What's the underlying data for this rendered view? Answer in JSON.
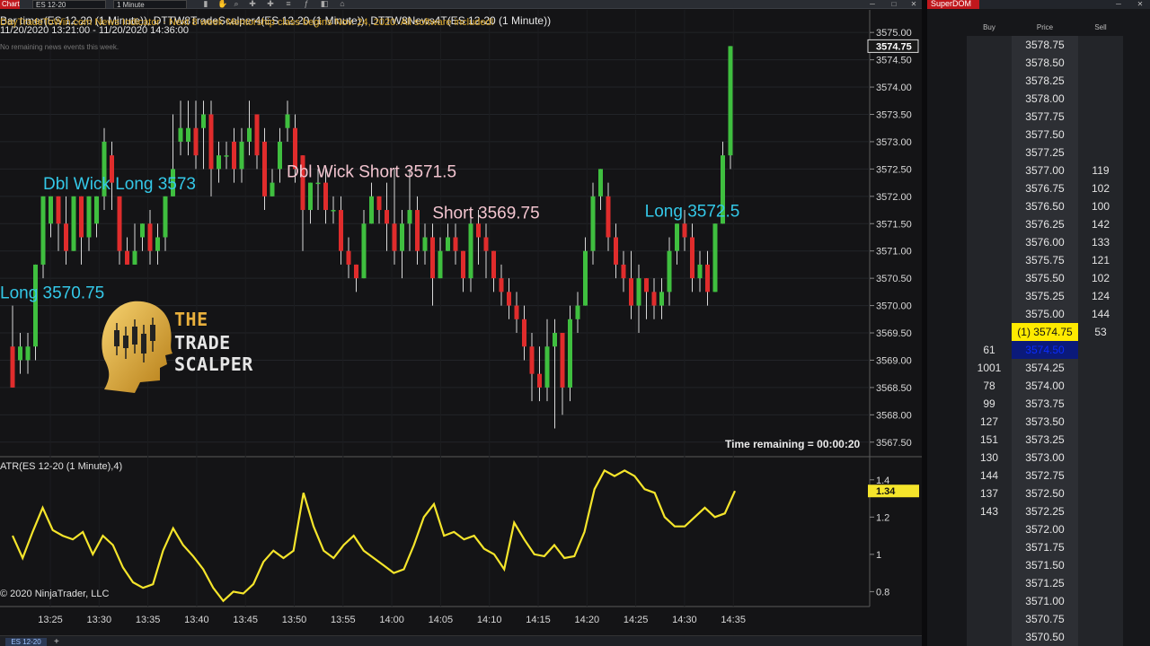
{
  "toolbar": {
    "tab_label": "Chart",
    "instrument": "ES 12-20",
    "interval": "1 Minute"
  },
  "header": {
    "title": "Bar timer(ES 12-20 (1 Minute)), DTTW8TradeScalper4(ES 12-20 (1 Minute)), DTTW8News4T(ES 12-20 (1 Minute))",
    "range": "11/20/2020 13:21:00 - 11/20/2020 14:36:00",
    "news": "DayTradeToWin.com News Indicator · Next 8 week Mentorship class begins Nov. 24, 2020. All software included!",
    "news2": "No remaining news events this week."
  },
  "logo": {
    "line1": "THE",
    "line2": "TRADE SCALPER"
  },
  "status": {
    "time_remaining": "Time remaining = 00:00:20",
    "copyright": "© 2020 NinjaTrader, LLC",
    "atr_label": "ATR(ES 12-20 (1 Minute),4)",
    "bottom_tab": "ES 12-20",
    "plus": "+"
  },
  "colors": {
    "up": "#3fbf3f",
    "down": "#e02c2c",
    "wick": "#d8d8d8",
    "atr_line": "#f5e52b",
    "signal_long": "#34c8e8",
    "signal_short": "#f2c4cf",
    "last_price_bg": "#ffea00"
  },
  "chart_data": [
    {
      "type": "candlestick",
      "title": "",
      "y_ticks": [
        3567.5,
        3568.0,
        3568.5,
        3569.0,
        3569.5,
        3570.0,
        3570.5,
        3571.0,
        3571.5,
        3572.0,
        3572.5,
        3573.0,
        3573.5,
        3574.0,
        3574.5,
        3575.0
      ],
      "y_tick_labels": [
        "3567.50",
        "3568.00",
        "3568.50",
        "3569.00",
        "3569.50",
        "3570.00",
        "3570.50",
        "3571.00",
        "3571.50",
        "3572.00",
        "3572.50",
        "3573.00",
        "3573.50",
        "3574.00",
        "3574.50",
        "3575.00"
      ],
      "ylim": [
        3567.25,
        3575.2
      ],
      "x_tick_labels": [
        "13:25",
        "13:30",
        "13:35",
        "13:40",
        "13:45",
        "13:50",
        "13:55",
        "14:00",
        "14:05",
        "14:10",
        "14:15",
        "14:20",
        "14:25",
        "14:30",
        "14:35"
      ],
      "last_price_label": "3574.75",
      "candles": [
        [
          3569.25,
          3568.5,
          3570.0,
          3568.5
        ],
        [
          3569.0,
          3569.25,
          3569.5,
          3568.75
        ],
        [
          3569.0,
          3569.25,
          3569.5,
          3568.75
        ],
        [
          3569.25,
          3570.75,
          3570.75,
          3569.0
        ],
        [
          3570.75,
          3572.0,
          3572.0,
          3570.5
        ],
        [
          3571.5,
          3572.0,
          3572.0,
          3571.25
        ],
        [
          3572.0,
          3571.5,
          3572.0,
          3571.0
        ],
        [
          3571.5,
          3571.0,
          3572.0,
          3570.75
        ],
        [
          3571.0,
          3572.0,
          3572.0,
          3571.0
        ],
        [
          3572.0,
          3571.25,
          3572.0,
          3570.75
        ],
        [
          3571.25,
          3572.0,
          3572.0,
          3571.0
        ],
        [
          3571.5,
          3572.0,
          3572.0,
          3571.25
        ],
        [
          3572.0,
          3573.0,
          3573.25,
          3571.75
        ],
        [
          3572.75,
          3572.25,
          3573.0,
          3571.75
        ],
        [
          3572.0,
          3571.0,
          3572.0,
          3570.75
        ],
        [
          3571.0,
          3570.75,
          3571.25,
          3570.75
        ],
        [
          3570.75,
          3571.0,
          3571.5,
          3570.75
        ],
        [
          3571.25,
          3571.5,
          3571.5,
          3571.0
        ],
        [
          3571.5,
          3571.0,
          3571.75,
          3570.75
        ],
        [
          3571.0,
          3571.25,
          3571.5,
          3570.75
        ],
        [
          3571.25,
          3572.0,
          3572.0,
          3571.0
        ],
        [
          3572.0,
          3572.5,
          3573.5,
          3572.0
        ],
        [
          3573.0,
          3573.25,
          3573.75,
          3572.75
        ],
        [
          3573.0,
          3573.25,
          3573.75,
          3572.75
        ],
        [
          3573.25,
          3572.75,
          3573.75,
          3572.5
        ],
        [
          3573.25,
          3573.5,
          3573.75,
          3572.5
        ],
        [
          3573.5,
          3572.5,
          3573.75,
          3572.0
        ],
        [
          3572.5,
          3572.75,
          3573.0,
          3572.25
        ],
        [
          3572.75,
          3572.75,
          3573.0,
          3572.5
        ],
        [
          3573.0,
          3572.5,
          3573.25,
          3572.25
        ],
        [
          3572.5,
          3573.0,
          3573.25,
          3572.25
        ],
        [
          3573.0,
          3573.25,
          3573.75,
          3572.75
        ],
        [
          3573.5,
          3572.75,
          3573.5,
          3572.5
        ],
        [
          3573.0,
          3572.0,
          3573.25,
          3571.75
        ],
        [
          3572.0,
          3572.25,
          3572.5,
          3572.0
        ],
        [
          3572.5,
          3573.0,
          3573.25,
          3572.25
        ],
        [
          3573.25,
          3573.5,
          3573.75,
          3573.0
        ],
        [
          3573.25,
          3572.5,
          3573.5,
          3572.25
        ],
        [
          3572.75,
          3571.75,
          3572.75,
          3571.0
        ],
        [
          3571.75,
          3572.25,
          3572.25,
          3571.5
        ],
        [
          3572.25,
          3572.25,
          3572.5,
          3571.75
        ],
        [
          3572.25,
          3571.75,
          3572.5,
          3571.5
        ],
        [
          3571.75,
          3571.75,
          3572.0,
          3571.5
        ],
        [
          3571.75,
          3571.0,
          3572.0,
          3570.75
        ],
        [
          3571.0,
          3570.75,
          3571.25,
          3570.5
        ],
        [
          3570.75,
          3570.5,
          3570.75,
          3570.25
        ],
        [
          3570.5,
          3571.5,
          3571.75,
          3570.5
        ],
        [
          3571.5,
          3572.0,
          3572.25,
          3571.5
        ],
        [
          3572.0,
          3571.75,
          3572.0,
          3571.5
        ],
        [
          3571.75,
          3571.5,
          3572.25,
          3571.0
        ],
        [
          3571.5,
          3571.0,
          3572.5,
          3570.75
        ],
        [
          3571.0,
          3571.5,
          3571.75,
          3570.5
        ],
        [
          3571.5,
          3571.75,
          3572.5,
          3571.0
        ],
        [
          3571.75,
          3571.0,
          3572.0,
          3570.75
        ],
        [
          3571.0,
          3571.25,
          3571.5,
          3570.75
        ],
        [
          3571.25,
          3570.5,
          3571.5,
          3570.0
        ],
        [
          3570.5,
          3571.0,
          3571.25,
          3570.5
        ],
        [
          3571.0,
          3571.25,
          3571.5,
          3571.0
        ],
        [
          3571.25,
          3571.0,
          3571.5,
          3570.75
        ],
        [
          3571.0,
          3570.5,
          3571.0,
          3570.25
        ],
        [
          3570.5,
          3571.5,
          3571.75,
          3570.25
        ],
        [
          3571.5,
          3571.25,
          3571.75,
          3570.75
        ],
        [
          3571.25,
          3571.0,
          3571.5,
          3570.5
        ],
        [
          3571.0,
          3570.5,
          3571.0,
          3570.25
        ],
        [
          3570.5,
          3570.25,
          3570.75,
          3570.0
        ],
        [
          3570.25,
          3570.0,
          3570.5,
          3569.75
        ],
        [
          3570.0,
          3569.75,
          3570.25,
          3569.5
        ],
        [
          3569.75,
          3569.25,
          3570.0,
          3569.0
        ],
        [
          3569.25,
          3568.75,
          3569.5,
          3568.25
        ],
        [
          3568.75,
          3568.5,
          3569.25,
          3568.25
        ],
        [
          3568.5,
          3569.25,
          3569.75,
          3568.25
        ],
        [
          3569.25,
          3569.5,
          3569.75,
          3567.75
        ],
        [
          3569.5,
          3568.5,
          3569.5,
          3568.0
        ],
        [
          3568.5,
          3569.75,
          3570.0,
          3568.25
        ],
        [
          3569.75,
          3570.0,
          3570.25,
          3569.5
        ],
        [
          3570.0,
          3571.0,
          3571.25,
          3570.0
        ],
        [
          3571.0,
          3572.0,
          3572.25,
          3570.75
        ],
        [
          3572.0,
          3572.5,
          3572.5,
          3571.75
        ],
        [
          3572.0,
          3571.25,
          3572.25,
          3571.0
        ],
        [
          3571.25,
          3570.75,
          3571.5,
          3570.5
        ],
        [
          3570.75,
          3570.5,
          3571.0,
          3570.25
        ],
        [
          3570.5,
          3570.0,
          3571.0,
          3569.75
        ],
        [
          3570.0,
          3570.5,
          3570.75,
          3569.5
        ],
        [
          3570.5,
          3570.25,
          3570.5,
          3569.75
        ],
        [
          3570.25,
          3570.0,
          3570.5,
          3569.75
        ],
        [
          3570.0,
          3570.25,
          3570.5,
          3569.75
        ],
        [
          3570.25,
          3571.0,
          3571.25,
          3570.0
        ],
        [
          3571.0,
          3571.5,
          3571.5,
          3570.75
        ],
        [
          3571.5,
          3571.25,
          3571.75,
          3571.0
        ],
        [
          3571.25,
          3570.5,
          3571.5,
          3570.25
        ],
        [
          3570.5,
          3570.75,
          3571.0,
          3570.25
        ],
        [
          3570.75,
          3570.25,
          3571.0,
          3570.0
        ],
        [
          3570.25,
          3571.5,
          3571.5,
          3570.25
        ],
        [
          3571.5,
          3572.75,
          3573.0,
          3571.5
        ],
        [
          3572.75,
          3574.75,
          3574.75,
          3572.5
        ]
      ],
      "annotations": [
        {
          "text": "Dbl Wick Long 3573",
          "kind": "long",
          "bar": 14
        },
        {
          "text": "Long 3570.75",
          "kind": "long",
          "bar": 0
        },
        {
          "text": "Dbl Wick Short 3571.5",
          "kind": "short",
          "bar": 47
        },
        {
          "text": "Short 3569.75",
          "kind": "short",
          "bar": 62
        },
        {
          "text": "Long 3572.5",
          "kind": "long",
          "bar": 89
        }
      ]
    },
    {
      "type": "line",
      "title": "ATR(ES 12-20 (1 Minute),4)",
      "y_ticks": [
        0.8,
        1.0,
        1.2,
        1.4
      ],
      "y_tick_labels": [
        "0.8",
        "1",
        "1.2",
        "1.4"
      ],
      "ylim": [
        0.72,
        1.5
      ],
      "last_value_label": "1.34",
      "values": [
        1.1,
        0.98,
        1.12,
        1.25,
        1.13,
        1.1,
        1.08,
        1.12,
        1.0,
        1.1,
        1.05,
        0.93,
        0.85,
        0.82,
        0.84,
        1.02,
        1.14,
        1.05,
        0.99,
        0.92,
        0.82,
        0.75,
        0.8,
        0.79,
        0.84,
        0.96,
        1.02,
        0.98,
        1.02,
        1.33,
        1.15,
        1.02,
        0.98,
        1.05,
        1.1,
        1.02,
        0.98,
        0.94,
        0.9,
        0.92,
        1.05,
        1.2,
        1.27,
        1.1,
        1.12,
        1.08,
        1.1,
        1.03,
        1.0,
        0.92,
        1.17,
        1.08,
        1.0,
        0.99,
        1.05,
        0.98,
        0.99,
        1.12,
        1.35,
        1.45,
        1.42,
        1.45,
        1.42,
        1.35,
        1.33,
        1.2,
        1.15,
        1.15,
        1.2,
        1.25,
        1.2,
        1.22,
        1.34
      ]
    }
  ],
  "dom": {
    "title": "SuperDOM",
    "head_buy": "Buy",
    "head_price": "Price",
    "head_sell": "Sell",
    "rows": [
      {
        "buy": "",
        "price": "3578.75",
        "sell": ""
      },
      {
        "buy": "",
        "price": "3578.50",
        "sell": ""
      },
      {
        "buy": "",
        "price": "3578.25",
        "sell": ""
      },
      {
        "buy": "",
        "price": "3578.00",
        "sell": ""
      },
      {
        "buy": "",
        "price": "3577.75",
        "sell": ""
      },
      {
        "buy": "",
        "price": "3577.50",
        "sell": ""
      },
      {
        "buy": "",
        "price": "3577.25",
        "sell": ""
      },
      {
        "buy": "",
        "price": "3577.00",
        "sell": "119"
      },
      {
        "buy": "",
        "price": "3576.75",
        "sell": "102"
      },
      {
        "buy": "",
        "price": "3576.50",
        "sell": "100"
      },
      {
        "buy": "",
        "price": "3576.25",
        "sell": "142"
      },
      {
        "buy": "",
        "price": "3576.00",
        "sell": "133"
      },
      {
        "buy": "",
        "price": "3575.75",
        "sell": "121"
      },
      {
        "buy": "",
        "price": "3575.50",
        "sell": "102"
      },
      {
        "buy": "",
        "price": "3575.25",
        "sell": "124"
      },
      {
        "buy": "",
        "price": "3575.00",
        "sell": "144"
      },
      {
        "buy": "",
        "price": "(1) 3574.75",
        "sell": "53",
        "state": "last"
      },
      {
        "buy": "61",
        "price": "3574.50",
        "sell": "",
        "state": "bid"
      },
      {
        "buy": "1001",
        "price": "3574.25",
        "sell": ""
      },
      {
        "buy": "78",
        "price": "3574.00",
        "sell": ""
      },
      {
        "buy": "99",
        "price": "3573.75",
        "sell": ""
      },
      {
        "buy": "127",
        "price": "3573.50",
        "sell": ""
      },
      {
        "buy": "151",
        "price": "3573.25",
        "sell": ""
      },
      {
        "buy": "130",
        "price": "3573.00",
        "sell": ""
      },
      {
        "buy": "144",
        "price": "3572.75",
        "sell": ""
      },
      {
        "buy": "137",
        "price": "3572.50",
        "sell": ""
      },
      {
        "buy": "143",
        "price": "3572.25",
        "sell": ""
      },
      {
        "buy": "",
        "price": "3572.00",
        "sell": ""
      },
      {
        "buy": "",
        "price": "3571.75",
        "sell": ""
      },
      {
        "buy": "",
        "price": "3571.50",
        "sell": ""
      },
      {
        "buy": "",
        "price": "3571.25",
        "sell": ""
      },
      {
        "buy": "",
        "price": "3571.00",
        "sell": ""
      },
      {
        "buy": "",
        "price": "3570.75",
        "sell": ""
      },
      {
        "buy": "",
        "price": "3570.50",
        "sell": ""
      }
    ]
  }
}
